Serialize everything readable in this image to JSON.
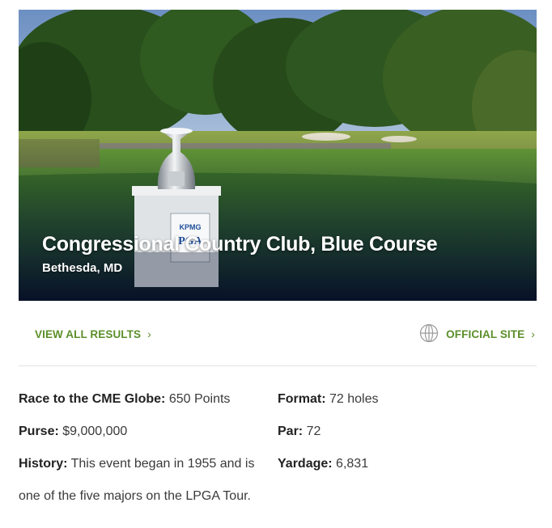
{
  "hero": {
    "title": "Congressional Country Club, Blue Course",
    "location": "Bethesda, MD",
    "trophy_plaque_text": "KPMG PGA"
  },
  "actions": {
    "view_all_results": "VIEW ALL RESULTS",
    "official_site": "OFFICIAL SITE",
    "globe_icon": "globe-icon",
    "chevron_icon": "chevron-right-icon"
  },
  "details": {
    "race_label": "Race to the CME Globe:",
    "race_value": "650 Points",
    "purse_label": "Purse:",
    "purse_value": "$9,000,000",
    "history_label": "History:",
    "history_value_line1": "This event began in 1955 and is",
    "history_value_line2": "one of the five majors on the LPGA Tour.",
    "format_label": "Format:",
    "format_value": "72 holes",
    "par_label": "Par:",
    "par_value": "72",
    "yardage_label": "Yardage:",
    "yardage_value": "6,831"
  },
  "colors": {
    "accent_green": "#5b8f2a",
    "divider": "#e2e2e2"
  }
}
